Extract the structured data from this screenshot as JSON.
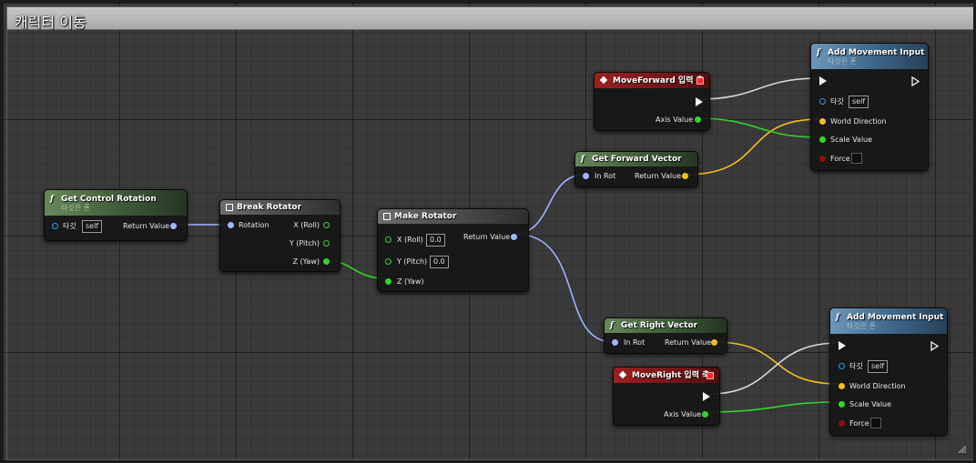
{
  "comment": {
    "title": "캐릭터 이동"
  },
  "colors": {
    "exec": "#f5f5f5",
    "rotator": "#a1b4ff",
    "vector": "#f0c022",
    "float": "#33d42a",
    "object": "#1e9ef0",
    "bool": "#8e1010"
  },
  "nodes": {
    "get_control_rotation": {
      "title": "Get Control Rotation",
      "subtitle": "타깃은 폰",
      "target_label": "타깃",
      "target_value": "self",
      "return_label": "Return Value"
    },
    "break_rotator": {
      "title": "Break Rotator",
      "rotation_label": "Rotation",
      "x_label": "X (Roll)",
      "y_label": "Y (Pitch)",
      "z_label": "Z (Yaw)"
    },
    "make_rotator": {
      "title": "Make Rotator",
      "x_label": "X (Roll)",
      "x_value": "0.0",
      "y_label": "Y (Pitch)",
      "y_value": "0.0",
      "z_label": "Z (Yaw)",
      "return_label": "Return Value"
    },
    "get_forward_vector": {
      "title": "Get Forward Vector",
      "in_label": "In Rot",
      "return_label": "Return Value"
    },
    "get_right_vector": {
      "title": "Get Right Vector",
      "in_label": "In Rot",
      "return_label": "Return Value"
    },
    "move_forward_event": {
      "title": "MoveForward 입력 축",
      "axis_label": "Axis Value"
    },
    "move_right_event": {
      "title": "MoveRight 입력 축",
      "axis_label": "Axis Value"
    },
    "add_movement_input_1": {
      "title": "Add Movement Input",
      "subtitle": "타깃은 폰",
      "target_label": "타깃",
      "target_value": "self",
      "world_direction_label": "World Direction",
      "scale_value_label": "Scale Value",
      "force_label": "Force"
    },
    "add_movement_input_2": {
      "title": "Add Movement Input",
      "subtitle": "타깃은 폰",
      "target_label": "타깃",
      "target_value": "self",
      "world_direction_label": "World Direction",
      "scale_value_label": "Scale Value",
      "force_label": "Force"
    }
  }
}
